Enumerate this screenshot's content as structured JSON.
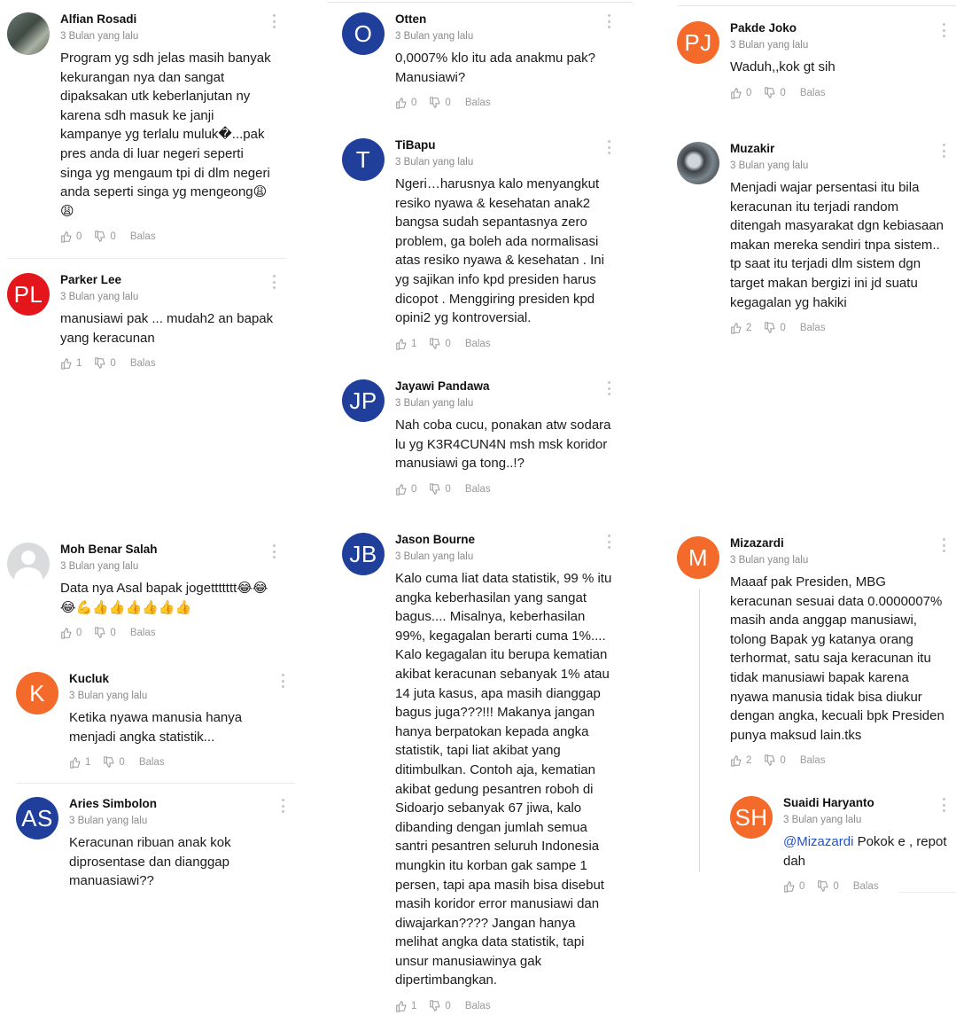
{
  "actions": {
    "reply": "Balas"
  },
  "colors": {
    "blue": "#1f3f9b",
    "red": "#e3171b",
    "orange": "#f36a2a",
    "mention": "#2453c7"
  },
  "comments": [
    {
      "name": "Alfian Rosadi",
      "time": "3 Bulan yang lalu",
      "text": "Program yg sdh jelas masih banyak\nkekurangan nya dan sangat\ndipaksakan utk keberlanjutan ny\nkarena sdh masuk ke janji\nkampanye yg terlalu muluk�...pak\npres anda di luar negeri seperti\nsinga yg mengaum tpi di dlm negeri\nanda seperti singa yg mengeong😩\n😩",
      "likes": "0",
      "dislikes": "0"
    },
    {
      "name": "Parker Lee",
      "initials": "PL",
      "time": "3 Bulan yang lalu",
      "text": "manusiawi pak ... mudah2 an bapak\nyang keracunan",
      "likes": "1",
      "dislikes": "0"
    },
    {
      "name": "Moh Benar Salah",
      "time": "3 Bulan yang lalu",
      "text": "Data nya Asal bapak jogettttttt😂😂\n😂💪👍👍👍👍👍👍",
      "likes": "0",
      "dislikes": "0"
    },
    {
      "name": "Kucluk",
      "initials": "K",
      "time": "3 Bulan yang lalu",
      "text": "Ketika nyawa manusia hanya\nmenjadi angka statistik...",
      "likes": "1",
      "dislikes": "0"
    },
    {
      "name": "Aries Simbolon",
      "initials": "AS",
      "time": "3 Bulan yang lalu",
      "text": "Keracunan ribuan anak kok\ndiprosentase dan dianggap\nmanuasiawi??",
      "likes": "",
      "dislikes": ""
    },
    {
      "name": "Otten",
      "initials": "O",
      "time": "3 Bulan yang lalu",
      "text": "0,0007% klo itu ada anakmu pak?\nManusiawi?",
      "likes": "0",
      "dislikes": "0"
    },
    {
      "name": "TiBapu",
      "initials": "T",
      "time": "3 Bulan yang lalu",
      "text": "Ngeri…harusnya kalo menyangkut\nresiko nyawa & kesehatan anak2\nbangsa sudah sepantasnya zero\nproblem, ga boleh ada normalisasi\natas resiko nyawa & kesehatan . Ini\nyg sajikan info kpd presiden harus\ndicopot . Menggiring presiden kpd\nopini2 yg kontroversial.",
      "likes": "1",
      "dislikes": "0"
    },
    {
      "name": "Jayawi Pandawa",
      "initials": "JP",
      "time": "3 Bulan yang lalu",
      "text": "Nah coba cucu, ponakan atw sodara\nlu yg K3R4CUN4N msh msk koridor\nmanusiawi ga tong..!?",
      "likes": "0",
      "dislikes": "0"
    },
    {
      "name": "Jason Bourne",
      "initials": "JB",
      "time": "3 Bulan yang lalu",
      "text": "Kalo cuma liat data statistik, 99 % itu\nangka keberhasilan yang sangat\nbagus.... Misalnya, keberhasilan\n99%, kegagalan berarti cuma 1%....\nKalo kegagalan itu berupa kematian\nakibat keracunan sebanyak 1% atau\n14 juta kasus, apa masih dianggap\nbagus juga???!!! Makanya jangan\nhanya berpatokan kepada angka\nstatistik, tapi liat akibat yang\nditimbulkan. Contoh aja, kematian\nakibat gedung pesantren roboh di\nSidoarjo sebanyak 67 jiwa, kalo\ndibanding dengan jumlah semua\nsantri pesantren seluruh Indonesia\nmungkin itu korban gak sampe 1\npersen, tapi apa masih bisa disebut\nmasih koridor error manusiawi dan\ndiwajarkan???? Jangan hanya\nmelihat angka data statistik, tapi\nunsur manusiawinya gak\ndipertimbangkan.",
      "likes": "1",
      "dislikes": "0"
    },
    {
      "name": "Pakde Joko",
      "initials": "PJ",
      "time": "3 Bulan yang lalu",
      "text": "Waduh,,kok gt sih",
      "likes": "0",
      "dislikes": "0"
    },
    {
      "name": "Muzakir",
      "time": "3 Bulan yang lalu",
      "text": "Menjadi wajar persentasi itu bila\nkeracunan itu terjadi random\nditengah masyarakat dgn kebiasaan\nmakan mereka sendiri tnpa sistem..\ntp saat itu terjadi dlm sistem dgn\ntarget makan bergizi ini jd suatu\nkegagalan yg hakiki",
      "likes": "2",
      "dislikes": "0"
    },
    {
      "name": "Mizazardi",
      "initials": "M",
      "time": "3 Bulan yang lalu",
      "text": "Maaaf pak Presiden, MBG\nkeracunan sesuai data 0.0000007%\nmasih anda anggap manusiawi,\ntolong Bapak yg katanya orang\nterhormat, satu saja keracunan itu\ntidak manusiawi bapak karena\nnyawa manusia tidak bisa diukur\ndengan angka, kecuali bpk Presiden\npunya maksud lain.tks",
      "likes": "2",
      "dislikes": "0"
    },
    {
      "name": "Suaidi Haryanto",
      "initials": "SH",
      "time": "3 Bulan yang lalu",
      "mention": "@Mizazardi",
      "text": " Pokok e , repot\ndah",
      "likes": "0",
      "dislikes": "0"
    }
  ]
}
